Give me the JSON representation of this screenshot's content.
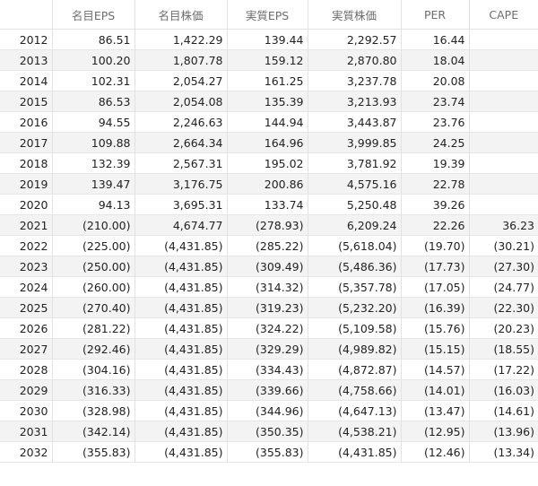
{
  "table": {
    "headers": [
      "",
      "名目EPS",
      "名目株価",
      "実質EPS",
      "実質株価",
      "PER",
      "CAPE"
    ],
    "rows": [
      [
        "2012",
        "86.51",
        "1,422.29",
        "139.44",
        "2,292.57",
        "16.44",
        ""
      ],
      [
        "2013",
        "100.20",
        "1,807.78",
        "159.12",
        "2,870.80",
        "18.04",
        ""
      ],
      [
        "2014",
        "102.31",
        "2,054.27",
        "161.25",
        "3,237.78",
        "20.08",
        ""
      ],
      [
        "2015",
        "86.53",
        "2,054.08",
        "135.39",
        "3,213.93",
        "23.74",
        ""
      ],
      [
        "2016",
        "94.55",
        "2,246.63",
        "144.94",
        "3,443.87",
        "23.76",
        ""
      ],
      [
        "2017",
        "109.88",
        "2,664.34",
        "164.96",
        "3,999.85",
        "24.25",
        ""
      ],
      [
        "2018",
        "132.39",
        "2,567.31",
        "195.02",
        "3,781.92",
        "19.39",
        ""
      ],
      [
        "2019",
        "139.47",
        "3,176.75",
        "200.86",
        "4,575.16",
        "22.78",
        ""
      ],
      [
        "2020",
        "94.13",
        "3,695.31",
        "133.74",
        "5,250.48",
        "39.26",
        ""
      ],
      [
        "2021",
        "(210.00)",
        "4,674.77",
        "(278.93)",
        "6,209.24",
        "22.26",
        "36.23"
      ],
      [
        "2022",
        "(225.00)",
        "(4,431.85)",
        "(285.22)",
        "(5,618.04)",
        "(19.70)",
        "(30.21)"
      ],
      [
        "2023",
        "(250.00)",
        "(4,431.85)",
        "(309.49)",
        "(5,486.36)",
        "(17.73)",
        "(27.30)"
      ],
      [
        "2024",
        "(260.00)",
        "(4,431.85)",
        "(314.32)",
        "(5,357.78)",
        "(17.05)",
        "(24.77)"
      ],
      [
        "2025",
        "(270.40)",
        "(4,431.85)",
        "(319.23)",
        "(5,232.20)",
        "(16.39)",
        "(22.30)"
      ],
      [
        "2026",
        "(281.22)",
        "(4,431.85)",
        "(324.22)",
        "(5,109.58)",
        "(15.76)",
        "(20.23)"
      ],
      [
        "2027",
        "(292.46)",
        "(4,431.85)",
        "(329.29)",
        "(4,989.82)",
        "(15.15)",
        "(18.55)"
      ],
      [
        "2028",
        "(304.16)",
        "(4,431.85)",
        "(334.43)",
        "(4,872.87)",
        "(14.57)",
        "(17.22)"
      ],
      [
        "2029",
        "(316.33)",
        "(4,431.85)",
        "(339.66)",
        "(4,758.66)",
        "(14.01)",
        "(16.03)"
      ],
      [
        "2030",
        "(328.98)",
        "(4,431.85)",
        "(344.96)",
        "(4,647.13)",
        "(13.47)",
        "(14.61)"
      ],
      [
        "2031",
        "(342.14)",
        "(4,431.85)",
        "(350.35)",
        "(4,538.21)",
        "(12.95)",
        "(13.96)"
      ],
      [
        "2032",
        "(355.83)",
        "(4,431.85)",
        "(355.83)",
        "(4,431.85)",
        "(12.46)",
        "(13.34)"
      ]
    ]
  }
}
